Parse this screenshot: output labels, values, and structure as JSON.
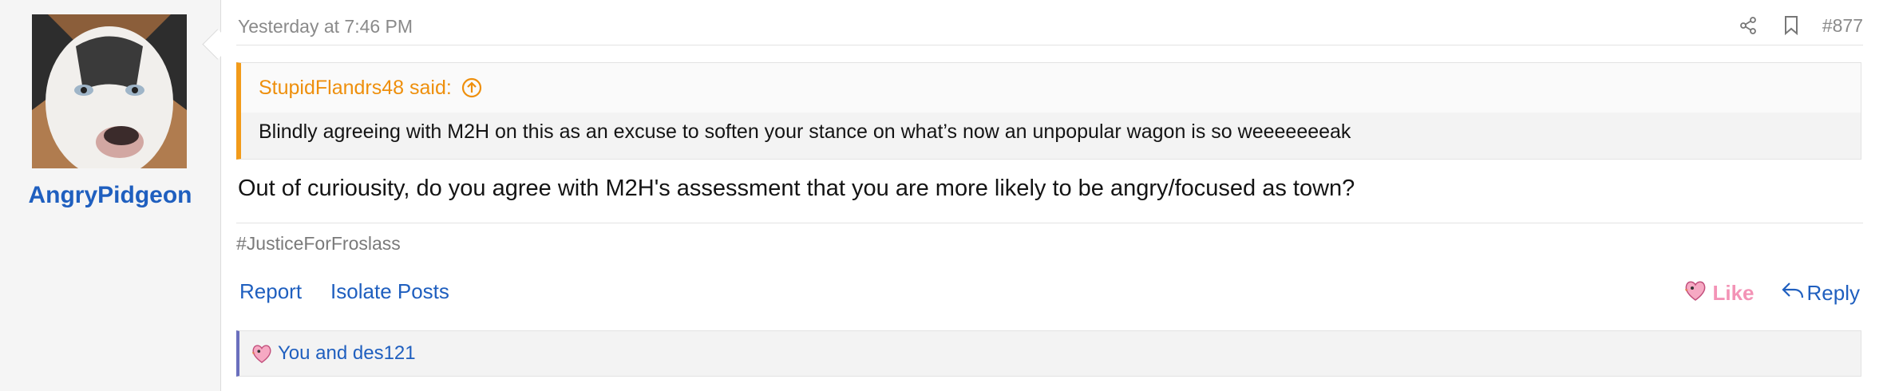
{
  "author": {
    "username": "AngryPidgeon"
  },
  "post": {
    "timestamp": "Yesterday at 7:46 PM",
    "number": "#877",
    "quote": {
      "author_said": "StupidFlandrs48 said:",
      "text": "Blindly agreeing with M2H on this as an excuse to soften your stance on what’s now an unpopular wagon is so weeeeeeeak"
    },
    "message": "Out of curiousity, do you agree with M2H's assessment that you are more likely to be angry/focused as town?",
    "signature": "#JusticeForFroslass"
  },
  "actions": {
    "report": "Report",
    "isolate": "Isolate Posts",
    "like": "Like",
    "reply": "Reply"
  },
  "reactions": {
    "text": "You and des121"
  },
  "icons": {
    "share": "share-icon",
    "bookmark": "bookmark-icon",
    "quote_jump": "arrow-up-circle-icon",
    "like": "heart-bird-icon",
    "reply": "reply-arrow-icon"
  },
  "colors": {
    "link": "#1f5fbf",
    "quote_accent": "#f29b1a",
    "like": "#f393b6",
    "reaction_accent": "#6a6fbd"
  }
}
